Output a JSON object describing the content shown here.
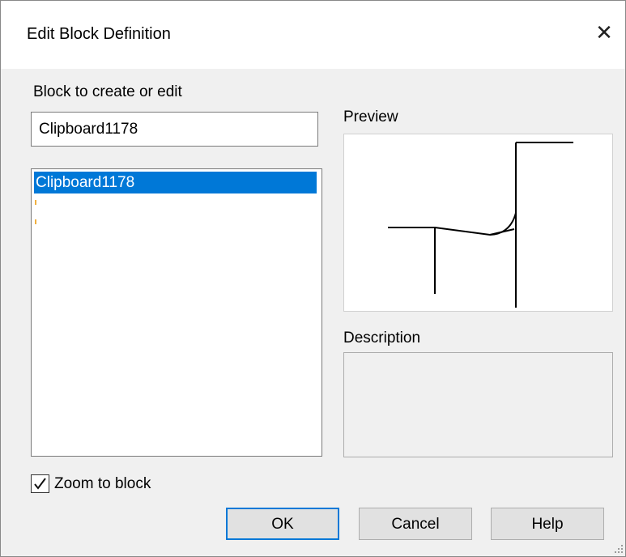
{
  "dialog": {
    "title": "Edit Block Definition",
    "close_icon": "close-icon"
  },
  "block": {
    "label": "Block to create or edit",
    "input_value": "Clipboard1178",
    "list_items": [
      "Clipboard1178"
    ]
  },
  "preview": {
    "label": "Preview"
  },
  "description": {
    "label": "Description",
    "value": ""
  },
  "options": {
    "zoom_to_block_label": "Zoom to block",
    "zoom_to_block_checked": true
  },
  "buttons": {
    "ok": "OK",
    "cancel": "Cancel",
    "help": "Help"
  },
  "colors": {
    "selection": "#0078d7",
    "default_button_border": "#0078d7"
  }
}
